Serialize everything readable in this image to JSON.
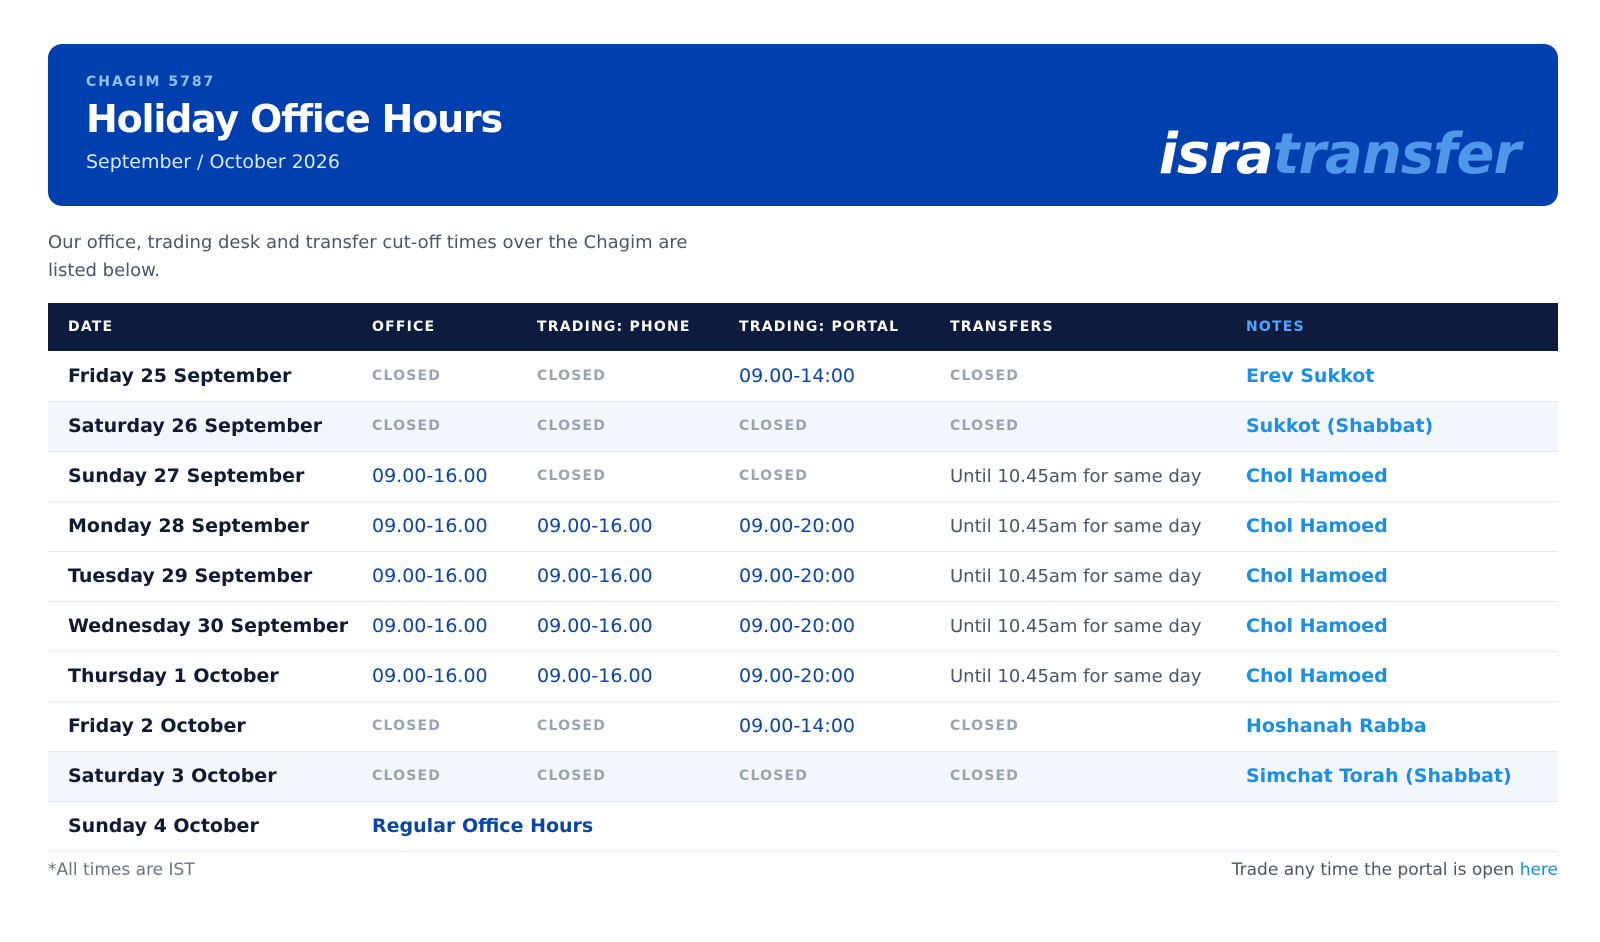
{
  "banner": {
    "eyebrow": "CHAGIM 5787",
    "title": "Holiday Office Hours",
    "subtitle": "September / October 2026",
    "logo_part1": "isra",
    "logo_part2": "transfer"
  },
  "intro": "Our office, trading desk and transfer cut-off times over the Chagim are listed below.",
  "table": {
    "headers": {
      "date": "DATE",
      "office": "OFFICE",
      "phone": "TRADING: PHONE",
      "portal": "TRADING: PORTAL",
      "transfers": "TRANSFERS",
      "notes": "NOTES"
    },
    "rows": [
      {
        "date": "Friday 25 September",
        "office": "CLOSED",
        "phone": "CLOSED",
        "portal": "09.00-14:00",
        "transfers": "CLOSED",
        "notes": "Erev Sukkot"
      },
      {
        "date": "Saturday 26 September",
        "office": "CLOSED",
        "phone": "CLOSED",
        "portal": "CLOSED",
        "transfers": "CLOSED",
        "notes": "Sukkot (Shabbat)"
      },
      {
        "date": "Sunday 27 September",
        "office": "09.00-16.00",
        "phone": "CLOSED",
        "portal": "CLOSED",
        "transfers": "Until 10.45am for same day",
        "notes": "Chol Hamoed"
      },
      {
        "date": "Monday 28 September",
        "office": "09.00-16.00",
        "phone": "09.00-16.00",
        "portal": "09.00-20:00",
        "transfers": "Until 10.45am for same day",
        "notes": "Chol Hamoed"
      },
      {
        "date": "Tuesday 29 September",
        "office": "09.00-16.00",
        "phone": "09.00-16.00",
        "portal": "09.00-20:00",
        "transfers": "Until 10.45am for same day",
        "notes": "Chol Hamoed"
      },
      {
        "date": "Wednesday 30 September",
        "office": "09.00-16.00",
        "phone": "09.00-16.00",
        "portal": "09.00-20:00",
        "transfers": "Until 10.45am for same day",
        "notes": "Chol Hamoed"
      },
      {
        "date": "Thursday 1 October",
        "office": "09.00-16.00",
        "phone": "09.00-16.00",
        "portal": "09.00-20:00",
        "transfers": "Until 10.45am for same day",
        "notes": "Chol Hamoed"
      },
      {
        "date": "Friday 2 October",
        "office": "CLOSED",
        "phone": "CLOSED",
        "portal": "09.00-14:00",
        "transfers": "CLOSED",
        "notes": "Hoshanah Rabba"
      },
      {
        "date": "Saturday 3 October",
        "office": "CLOSED",
        "phone": "CLOSED",
        "portal": "CLOSED",
        "transfers": "CLOSED",
        "notes": "Simchat Torah (Shabbat)"
      }
    ],
    "last_row": {
      "date": "Sunday 4 October",
      "regular": "Regular Office Hours"
    }
  },
  "footer": {
    "note": "*All times are IST",
    "trade_text": "Trade any time the portal is open",
    "trade_link": "here"
  },
  "colors": {
    "banner": "#003fae",
    "header_row": "#0c1b3e",
    "time": "#0b45a8",
    "note": "#1a8fe3",
    "closed": "#9aa3b2"
  }
}
